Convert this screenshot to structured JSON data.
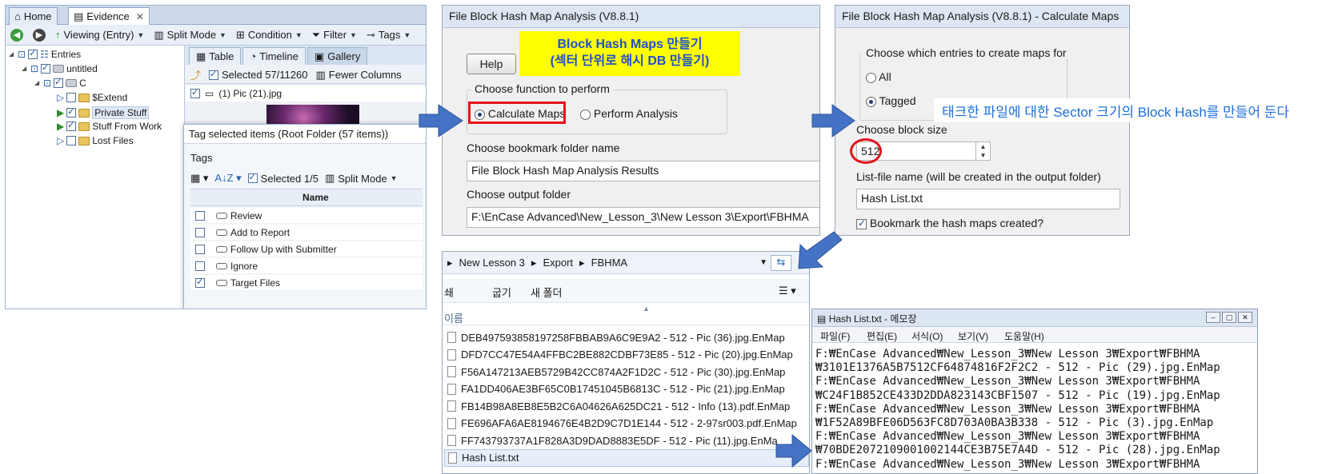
{
  "encase": {
    "tabs": [
      "Home",
      "Evidence"
    ],
    "toolbar": {
      "viewing": "Viewing (Entry)",
      "split": "Split Mode",
      "condition": "Condition",
      "filter": "Filter",
      "tags": "Tags"
    },
    "tree": [
      "Entries",
      "untitled",
      "C",
      "$Extend",
      "Private Stuff",
      "Stuff From Work",
      "Lost Files"
    ],
    "view_tabs": [
      "Table",
      "Timeline",
      "Gallery"
    ],
    "subbar": {
      "selected": "Selected 57/11260",
      "fewer": "Fewer Columns"
    },
    "gallery_item": "(1) Pic (21).jpg",
    "dialog": {
      "title": "Tag selected items (Root Folder (57 items))",
      "subtitle": "Tags",
      "selected": "Selected 1/5",
      "split": "Split Mode",
      "col_name": "Name",
      "rows": [
        {
          "label": "Review",
          "checked": false
        },
        {
          "label": "Add to Report",
          "checked": false
        },
        {
          "label": "Follow Up with Submitter",
          "checked": false
        },
        {
          "label": "Ignore",
          "checked": false
        },
        {
          "label": "Target Files",
          "checked": true
        }
      ]
    }
  },
  "bhm": {
    "title": "File Block Hash Map Analysis (V8.8.1)",
    "help": "Help",
    "callout_line1": "Block Hash Maps 만들기",
    "callout_line2": "(섹터 단위로 해시 DB 만들기)",
    "choose_function": "Choose function to perform",
    "opt_calc": "Calculate Maps",
    "opt_perform": "Perform Analysis",
    "bookmark_label": "Choose bookmark folder name",
    "bookmark_value": "File Block Hash Map Analysis Results",
    "output_label": "Choose output folder",
    "output_value": "F:\\EnCase Advanced\\New_Lesson_3\\New Lesson 3\\Export\\FBHMA"
  },
  "calc": {
    "title": "File Block Hash Map Analysis (V8.8.1) - Calculate Maps",
    "entries_label": "Choose which entries to create maps for",
    "opt_all": "All",
    "opt_tagged": "Tagged",
    "block_label": "Choose block size",
    "block_value": "512",
    "listfile_label": "List-file name (will be created in the output folder)",
    "listfile_value": "Hash List.txt",
    "bookmark_chk": "Bookmark the hash maps created?"
  },
  "note": "태크한 파일에 대한 Sector 크기의 Block Hash를 만들어 둔다",
  "explorer": {
    "breadcrumb": [
      "New Lesson 3",
      "Export",
      "FBHMA"
    ],
    "cmd": [
      "쇄",
      "굽기",
      "새 폴더"
    ],
    "col_name": "이름",
    "files": [
      "DEB497593858197258FBBAB9A6C9E9A2 - 512 - Pic (36).jpg.EnMap",
      "DFD7CC47E54A4FFBC2BE882CDBF73E85 - 512 - Pic (20).jpg.EnMap",
      "F56A147213AEB5729B42CC874A2F1D2C - 512 - Pic (30).jpg.EnMap",
      "FA1DD406AE3BF65C0B17451045B6813C - 512 - Pic (21).jpg.EnMap",
      "FB14B98A8EB8E5B2C6A04626A625DC21 - 512 - Info (13).pdf.EnMap",
      "FE696AFA6AE8194676E4B2D9C7D1E144 - 512 - 2-97sr003.pdf.EnMap",
      "FF743793737A1F828A3D9DAD8883E5DF - 512 - Pic (11).jpg.EnMa",
      "Hash List.txt"
    ]
  },
  "notepad": {
    "title": "Hash List.txt - 메모장",
    "menu": [
      "파일(F)",
      "편집(E)",
      "서식(O)",
      "보기(V)",
      "도움말(H)"
    ],
    "lines": [
      "F:₩EnCase Advanced₩New_Lesson_3₩New Lesson 3₩Export₩FBHMA",
      "₩3101E1376A5B7512CF64874816F2F2C2 - 512 - Pic (29).jpg.EnMap",
      "F:₩EnCase Advanced₩New_Lesson_3₩New Lesson 3₩Export₩FBHMA",
      "₩C24F1B852CE433D2DDA823143CBF1507 - 512 - Pic (19).jpg.EnMap",
      "F:₩EnCase Advanced₩New_Lesson_3₩New Lesson 3₩Export₩FBHMA",
      "₩1F52A89BFE06D563FC8D703A0BA3B338 - 512 - Pic (3).jpg.EnMap",
      "F:₩EnCase Advanced₩New_Lesson_3₩New Lesson 3₩Export₩FBHMA",
      "₩70BDE2072109001002144CE3B75E7A4D - 512 - Pic (28).jpg.EnMap",
      "F:₩EnCase Advanced₩New_Lesson_3₩New Lesson 3₩Export₩FBHMA"
    ]
  },
  "colors": {
    "arrow": "#4472c4",
    "highlight_red": "#e4141c",
    "callout_bg": "#ffff00",
    "callout_text": "#1f4fd0",
    "note_text": "#1d6fd8"
  }
}
